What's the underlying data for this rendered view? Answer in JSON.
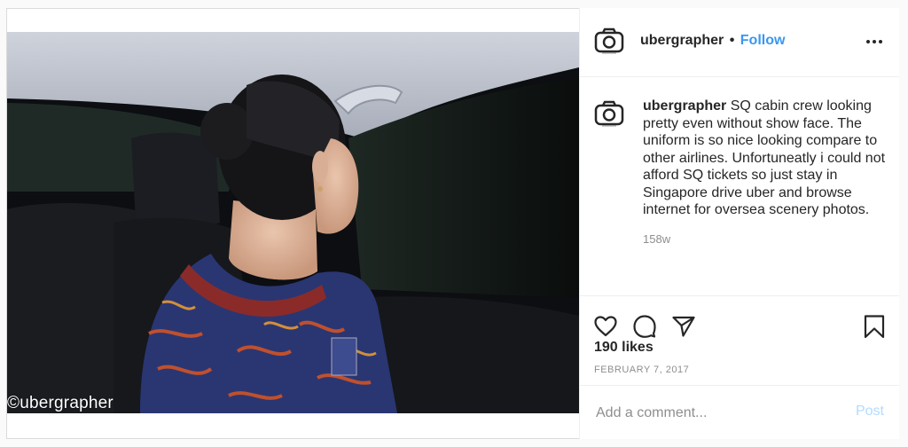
{
  "post": {
    "watermark": "©ubergrapher"
  },
  "header": {
    "username": "ubergrapher",
    "separator": "•",
    "follow_label": "Follow",
    "more_icon": "more-horizontal-icon"
  },
  "caption": {
    "username": "ubergrapher",
    "text": "SQ cabin crew looking pretty even without show face. The uniform is so nice looking compare to other airlines. Unfortuneatly i could not afford SQ tickets so just stay in Singapore drive uber and browse internet for oversea scenery photos.",
    "time_ago": "158w"
  },
  "actions": {
    "icons": [
      "heart-icon",
      "comment-icon",
      "share-icon",
      "bookmark-icon"
    ],
    "likes": "190 likes",
    "date": "FEBRUARY 7, 2017"
  },
  "comment_box": {
    "placeholder": "Add a comment...",
    "post_label": "Post"
  },
  "colors": {
    "accent": "#3897f0",
    "post_disabled": "#b3dbff",
    "muted": "#8e8e8e",
    "border": "#dbdbdb"
  }
}
